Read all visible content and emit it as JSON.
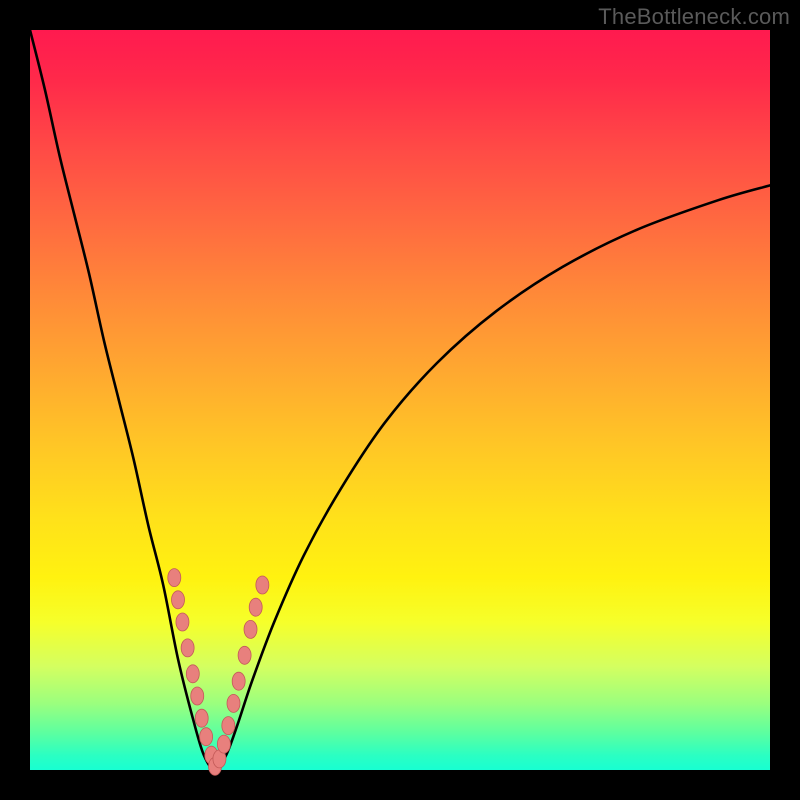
{
  "watermark": "TheBottleneck.com",
  "colors": {
    "frame": "#000000",
    "curve_stroke": "#000000",
    "marker_fill": "#e8807d",
    "marker_stroke": "#c35a58"
  },
  "chart_data": {
    "type": "line",
    "title": "",
    "xlabel": "",
    "ylabel": "",
    "xlim": [
      0,
      100
    ],
    "ylim": [
      0,
      100
    ],
    "series": [
      {
        "name": "bottleneck-curve",
        "x": [
          0,
          2,
          4,
          6,
          8,
          10,
          12,
          14,
          16,
          18,
          20,
          22,
          23.5,
          25,
          26.5,
          28,
          30,
          33,
          37,
          42,
          48,
          55,
          63,
          72,
          82,
          93,
          100
        ],
        "y": [
          100,
          92,
          83,
          75,
          67,
          58,
          50,
          42,
          33,
          25,
          15,
          7,
          2,
          0,
          2,
          6,
          12,
          20,
          29,
          38,
          47,
          55,
          62,
          68,
          73,
          77,
          79
        ]
      }
    ],
    "markers": {
      "note": "pink dotted segments near the V bottom",
      "points": [
        {
          "x": 19.5,
          "y": 26
        },
        {
          "x": 20.0,
          "y": 23
        },
        {
          "x": 20.6,
          "y": 20
        },
        {
          "x": 21.3,
          "y": 16.5
        },
        {
          "x": 22.0,
          "y": 13
        },
        {
          "x": 22.6,
          "y": 10
        },
        {
          "x": 23.2,
          "y": 7
        },
        {
          "x": 23.8,
          "y": 4.5
        },
        {
          "x": 24.5,
          "y": 2
        },
        {
          "x": 25.0,
          "y": 0.5
        },
        {
          "x": 25.6,
          "y": 1.5
        },
        {
          "x": 26.2,
          "y": 3.5
        },
        {
          "x": 26.8,
          "y": 6
        },
        {
          "x": 27.5,
          "y": 9
        },
        {
          "x": 28.2,
          "y": 12
        },
        {
          "x": 29.0,
          "y": 15.5
        },
        {
          "x": 29.8,
          "y": 19
        },
        {
          "x": 30.5,
          "y": 22
        },
        {
          "x": 31.4,
          "y": 25
        }
      ]
    }
  }
}
